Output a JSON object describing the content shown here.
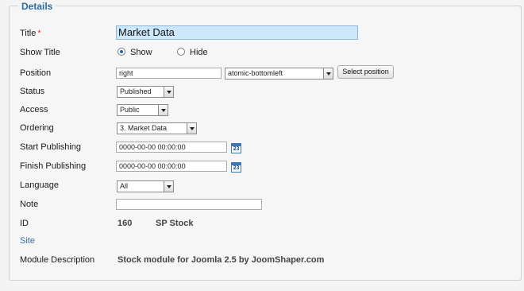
{
  "section": {
    "title": "Details"
  },
  "fields": {
    "title": {
      "label": "Title",
      "required_mark": "*",
      "value": "Market Data"
    },
    "show_title": {
      "label": "Show Title",
      "options": [
        "Show",
        "Hide"
      ],
      "selected": "Show"
    },
    "position": {
      "label": "Position",
      "value": "right",
      "select_value": "atomic-bottomleft",
      "button": "Select position"
    },
    "status": {
      "label": "Status",
      "value": "Published"
    },
    "access": {
      "label": "Access",
      "value": "Public"
    },
    "ordering": {
      "label": "Ordering",
      "value": "3. Market Data"
    },
    "start_publishing": {
      "label": "Start Publishing",
      "value": "0000-00-00 00:00:00"
    },
    "finish_publishing": {
      "label": "Finish Publishing",
      "value": "0000-00-00 00:00:00"
    },
    "language": {
      "label": "Language",
      "value": "All"
    },
    "note": {
      "label": "Note",
      "value": ""
    },
    "id": {
      "label": "ID",
      "value": "160",
      "extra": "SP Stock"
    },
    "site": {
      "label": "Site"
    },
    "module_description": {
      "label": "Module Description",
      "value": "Stock module for Joomla 2.5 by JoomShaper.com"
    }
  },
  "icons": {
    "calendar": "calendar-icon",
    "calendar_day": "23"
  }
}
